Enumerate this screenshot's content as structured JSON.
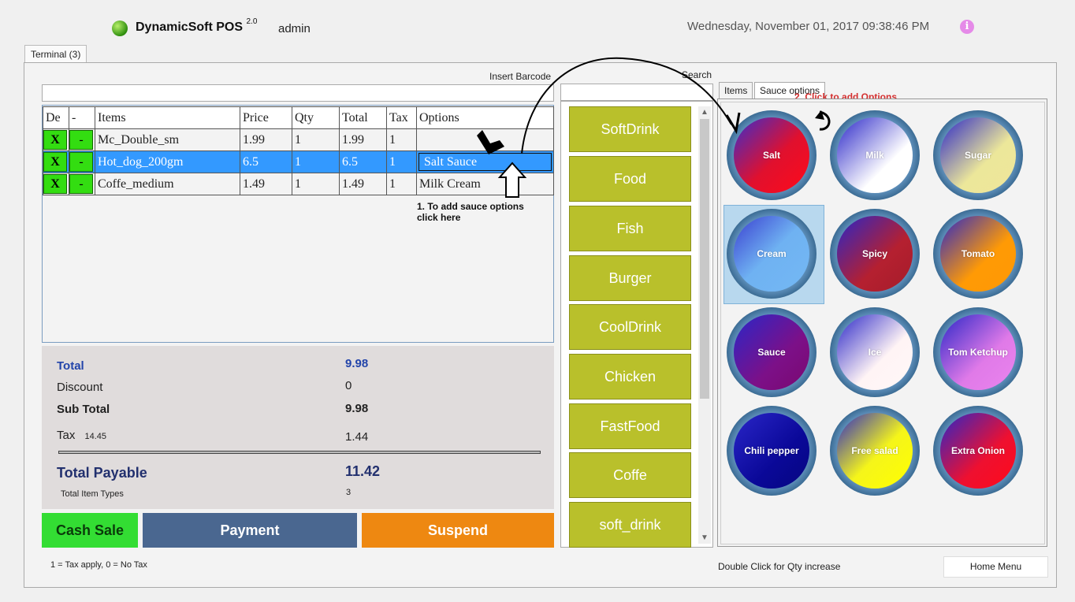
{
  "app": {
    "title": "DynamicSoft POS",
    "version": "2.0",
    "user": "admin",
    "datetime": "Wednesday,  November 01,  2017  09:38:46  PM"
  },
  "tabs": {
    "terminal": "Terminal (3)",
    "items": "Items",
    "sauce_options": "Sauce options"
  },
  "labels": {
    "insert_barcode": "Insert Barcode",
    "search": "Search",
    "tax_note": "1 = Tax apply, 0 = No Tax",
    "qty_note": "Double Click for Qty increase",
    "home_menu": "Home Menu"
  },
  "grid": {
    "headers": [
      "De",
      "-",
      "Items",
      "Price",
      "Qty",
      "Total",
      "Tax",
      "Options"
    ],
    "delete_label": "X",
    "minus_label": "-",
    "rows": [
      {
        "item": "Mc_Double_sm",
        "price": "1.99",
        "qty": "1",
        "total": "1.99",
        "tax": "1",
        "options": ""
      },
      {
        "item": "Hot_dog_200gm",
        "price": "6.5",
        "qty": "1",
        "total": "6.5",
        "tax": "1",
        "options": "Salt Sauce"
      },
      {
        "item": "Coffe_medium",
        "price": "1.49",
        "qty": "1",
        "total": "1.49",
        "tax": "1",
        "options": "Milk Cream"
      }
    ],
    "selected_row": 1
  },
  "annotations": {
    "step1_line1": "1. To add sauce options",
    "step1_line2": "click here",
    "step2": "2. Click to add Options"
  },
  "totals": {
    "total_label": "Total",
    "total_value": "9.98",
    "discount_label": "Discount",
    "discount_value": "0",
    "subtotal_label": "Sub Total",
    "subtotal_value": "9.98",
    "tax_label": "Tax",
    "tax_rate": "14.45",
    "tax_value": "1.44",
    "payable_label": "Total Payable",
    "payable_value": "11.42",
    "item_types_label": "Total Item Types",
    "item_types_value": "3"
  },
  "actions": {
    "cash_sale": "Cash Sale",
    "payment": "Payment",
    "suspend": "Suspend"
  },
  "colors": {
    "cash": "#33dd33",
    "payment": "#4a6790",
    "suspend": "#ee8811",
    "category": "#b9c02b",
    "selected": "#3399ff"
  },
  "categories": [
    "SoftDrink",
    "Food",
    "Fish",
    "Burger",
    "CoolDrink",
    "Chicken",
    "FastFood",
    "Coffe",
    "soft_drink"
  ],
  "sauce_options": [
    {
      "name": "Salt",
      "gradient": "linear-gradient(135deg,#3a2dcc 0%,#e0102e 55%,#ff0a1a 100%)"
    },
    {
      "name": "Milk",
      "gradient": "linear-gradient(135deg,#2a26c8 0%,#ffffff 65%,#ffffff 100%)"
    },
    {
      "name": "Sugar",
      "gradient": "linear-gradient(135deg,#2a26c8 0%,#ece79a 60%,#efe69a 100%)"
    },
    {
      "name": "Cream",
      "gradient": "linear-gradient(135deg,#3a3ed0 0%,#6fb2f2 50%,#74b8f4 100%)"
    },
    {
      "name": "Spicy",
      "gradient": "linear-gradient(135deg,#2a26c8 0%,#b52030 60%,#a51c2a 100%)"
    },
    {
      "name": "Tomato",
      "gradient": "linear-gradient(135deg,#2a26c8 0%,#ff9a05 60%,#ff9805 100%)"
    },
    {
      "name": "Sauce",
      "gradient": "linear-gradient(135deg,#2a26c8 0%,#7c1088 60%,#7a0870 100%)"
    },
    {
      "name": "Ice",
      "gradient": "linear-gradient(135deg,#2a26c8 0%,#fff4f5 60%,#fff7f7 100%)"
    },
    {
      "name": "Tom Ketchup",
      "gradient": "linear-gradient(135deg,#2a26c8 0%,#e07ae8 60%,#ea84ee 100%)"
    },
    {
      "name": "Chili pepper",
      "gradient": "linear-gradient(135deg,#2a26c8 0%,#0a0898 60%,#060680 100%)"
    },
    {
      "name": "Free salad",
      "gradient": "linear-gradient(135deg,#2a26c8 0%,#f5f51a 55%,#ffff00 100%)"
    },
    {
      "name": "Extra Onion",
      "gradient": "linear-gradient(135deg,#2a26c8 0%,#ee1030 60%,#ff0a1a 100%)"
    }
  ]
}
